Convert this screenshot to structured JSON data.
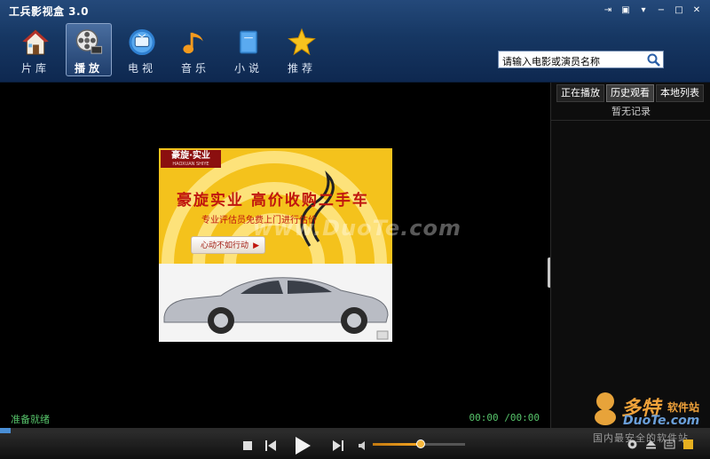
{
  "app": {
    "title": "工兵影视盒 3.0"
  },
  "window_controls": [
    {
      "name": "pin-icon",
      "glyph": "⇥"
    },
    {
      "name": "skin-icon",
      "glyph": "▣"
    },
    {
      "name": "menu-icon",
      "glyph": "▾"
    },
    {
      "name": "minimize-icon",
      "glyph": "−"
    },
    {
      "name": "maximize-icon",
      "glyph": "□"
    },
    {
      "name": "close-icon",
      "glyph": "✕"
    }
  ],
  "nav": {
    "items": [
      {
        "label": "片库",
        "icon": "house-icon"
      },
      {
        "label": "播放",
        "icon": "film-reel-icon",
        "active": true
      },
      {
        "label": "电视",
        "icon": "tv-icon"
      },
      {
        "label": "音乐",
        "icon": "music-note-icon"
      },
      {
        "label": "小说",
        "icon": "book-icon"
      },
      {
        "label": "推荐",
        "icon": "star-icon"
      }
    ]
  },
  "search": {
    "placeholder": "请输入电影或演员名称"
  },
  "ad": {
    "brand": "豪旋·实业",
    "brand_sub": "HAOXUAN SHIYE",
    "headline": "豪旋实业 高价收购二手车",
    "subline": "专业评估员免费上门进行估价",
    "cta": "心动不如行动",
    "cta_arrow": "▶"
  },
  "watermark": "www.DuoTe.com",
  "player": {
    "status": "准备就绪",
    "time": "00:00 /00:00",
    "progress": 0.015,
    "volume": 0.52
  },
  "panel": {
    "tabs": [
      {
        "label": "正在播放"
      },
      {
        "label": "历史观看",
        "active": true
      },
      {
        "label": "本地列表"
      }
    ],
    "empty_text": "暂无记录"
  },
  "corner_brand": {
    "name": "多特",
    "suffix": "软件站",
    "domain": "DuoTe.com",
    "slogan": "国内最安全的软件站"
  },
  "colors": {
    "titlebar": "#163763",
    "accent_green": "#56c36a",
    "volume_orange": "#f5a623",
    "progress_blue": "#4a8fd6"
  }
}
